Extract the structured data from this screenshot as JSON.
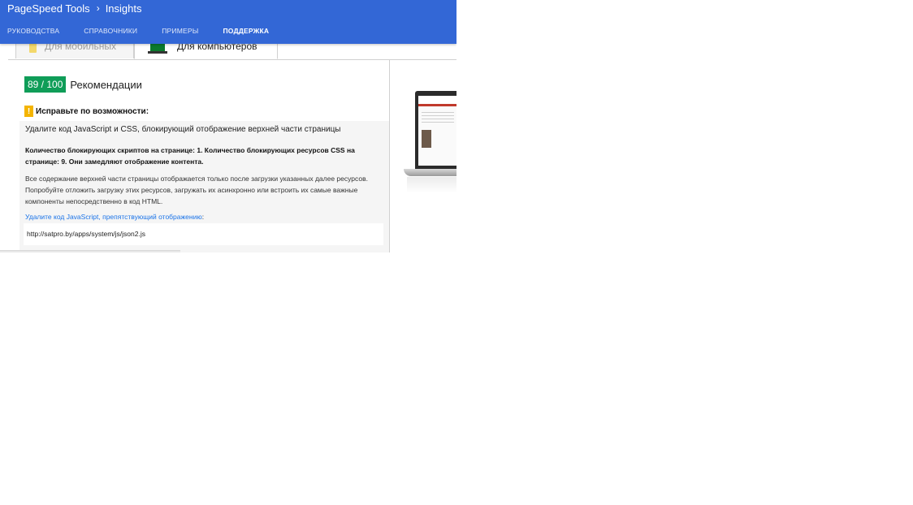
{
  "header": {
    "brand": "PageSpeed Tools",
    "separator": "›",
    "product": "Insights",
    "nav": [
      "РУКОВОДСТВА",
      "СПРАВОЧНИКИ",
      "ПРИМЕРЫ",
      "ПОДДЕРЖКА"
    ],
    "active_nav_index": 3,
    "color": "#3367d6"
  },
  "device_tabs": {
    "mobile": "Для мобильных",
    "desktop": "Для компьютеров",
    "selected": "desktop"
  },
  "score": {
    "value": "89 / 100",
    "label": "Рекомендации",
    "color": "#0f9d58"
  },
  "warning": {
    "icon": "!",
    "title": "Исправьте по возможности:",
    "color": "#f4b400"
  },
  "rule": {
    "heading": "Удалите код JavaScript и CSS, блокирующий отображение верхней части страницы",
    "summary": "Количество блокирующих скриптов на странице: 1. Количество блокирующих ресурсов CSS на странице: 9. Они замедляют отображение контента.",
    "description": "Все содержание верхней части страницы отображается только после загрузки указанных далее ресурсов. Попробуйте отложить загрузку этих ресурсов, загружать их асинхронно или встроить их самые важные компоненты непосредственно в код HTML.",
    "link": "Удалите код JavaScript, препятствующий отображению",
    "link_suffix": ":",
    "url": "http://satpro.by/apps/system/js/json2.js"
  },
  "icons": {
    "mobile_tab": "smartphone-icon",
    "desktop_tab": "laptop-icon",
    "warning": "warning-icon",
    "preview": "laptop-preview"
  }
}
